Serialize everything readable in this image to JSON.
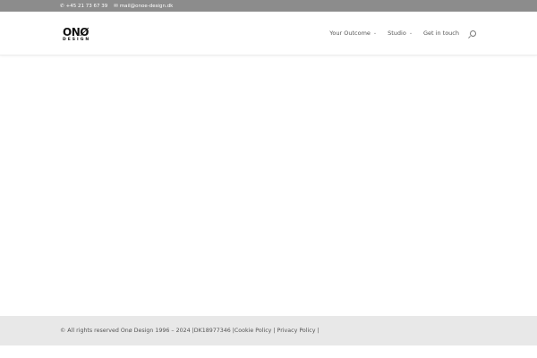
{
  "topbar": {
    "phone": "+45 21 73 67 39",
    "email": "mail@onoe-design.dk"
  },
  "logo": {
    "main": "ONØ",
    "sub": "DESIGN"
  },
  "nav": [
    {
      "label": "Your Outcome",
      "dropdown": "⌄"
    },
    {
      "label": "Studio",
      "dropdown": "⌄"
    },
    {
      "label": "Get in touch"
    }
  ],
  "footer": {
    "copyright": "© All rights reserved Onø Design 1996 – 2024 | ",
    "cvr": "DK18977346 | ",
    "cookie": "Cookie Policy",
    "sep1": " | ",
    "privacy": "Privacy Policy",
    "sep2": " |"
  }
}
